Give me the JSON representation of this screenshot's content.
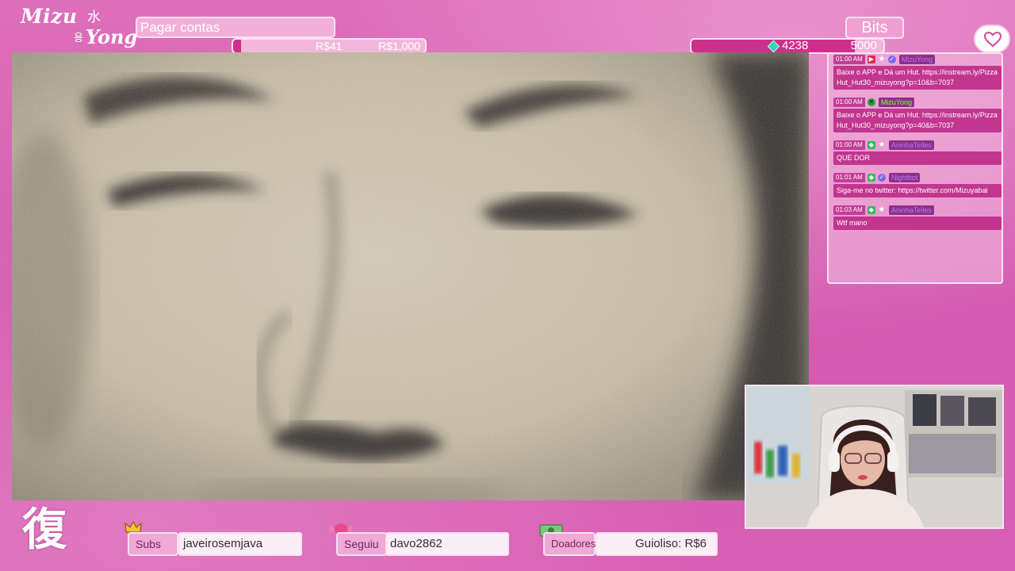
{
  "logo": {
    "word1": "Mizu",
    "kanji": "水",
    "hangul": "용",
    "word2": "Yong"
  },
  "goal": {
    "title": "Pagar contas",
    "current": "R$41",
    "target": "R$1,000",
    "progress_fraction": 0.04
  },
  "bits": {
    "label": "Bits",
    "current": "4238",
    "target": "5000",
    "progress_fraction": 0.85
  },
  "chat": {
    "messages": [
      {
        "time": "01:00 AM",
        "user": "MizuYong",
        "badges": [
          "red",
          "star",
          "check"
        ],
        "user_color": "purple",
        "text": "Baixe o APP e Dá um Hut. https://instream.ly/PizzaHut_Hut30_mizuyong?p=10&b=7037"
      },
      {
        "time": "01:00 AM",
        "user": "MizuYong",
        "badges": [
          "x"
        ],
        "user_color": "green",
        "text": "Baixe o APP e Dá um Hut. https://instream.ly/PizzaHut_Hut30_mizuyong?p=40&b=7037"
      },
      {
        "time": "01:00 AM",
        "user": "AninhaTelles",
        "badges": [
          "green",
          "star"
        ],
        "user_color": "purple",
        "text": "QUE DOR"
      },
      {
        "time": "01:01 AM",
        "user": "Nightbot",
        "badges": [
          "green",
          "check"
        ],
        "user_color": "purple",
        "text": "Siga-me no twitter: https://twitter.com/Mizuyabai"
      },
      {
        "time": "01:03 AM",
        "user": "AninhaTelles",
        "badges": [
          "green",
          "star"
        ],
        "user_color": "purple",
        "text": "Wtf mano"
      }
    ]
  },
  "bottom": {
    "emblem": "復",
    "subs": {
      "label": "Subs",
      "value": "javeirosemjava"
    },
    "follow": {
      "label": "Seguiu",
      "value": "davo2862"
    },
    "donors": {
      "label": "Doadores",
      "value": "Guioliso: R$6"
    }
  },
  "colors": {
    "accent": "#cf2f8c",
    "panel": "#d962b4",
    "chat_bubble": "#c2368f"
  }
}
